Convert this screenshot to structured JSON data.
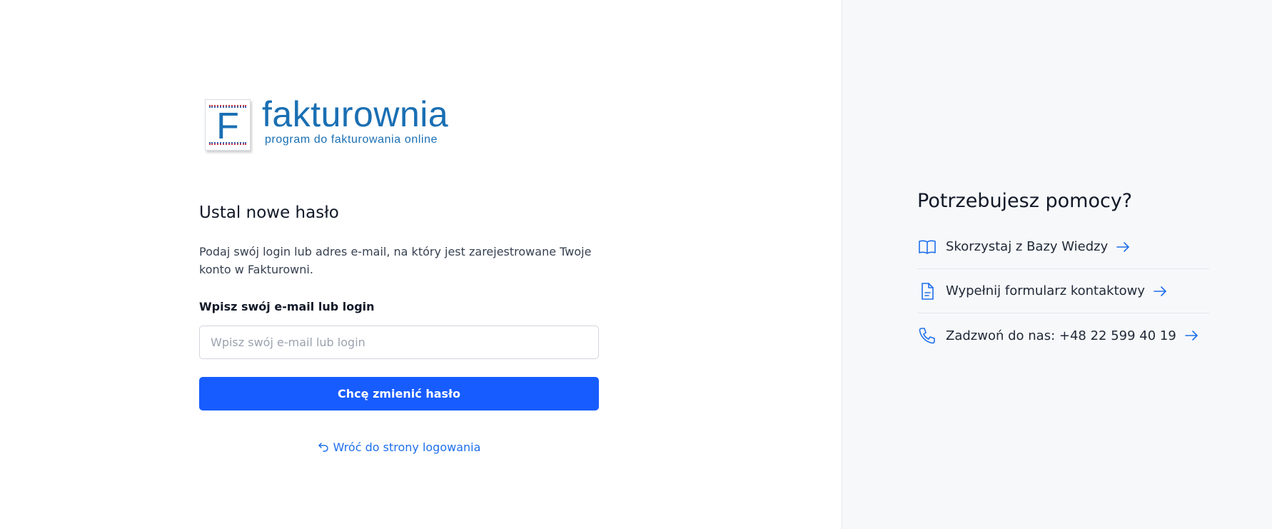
{
  "brand": {
    "logo_letter": "F",
    "name": "fakturownia",
    "tagline": "program do fakturowania online",
    "color": "#1a6fb3"
  },
  "form": {
    "title": "Ustal nowe hasło",
    "description": "Podaj swój login lub adres e-mail, na który jest zarejestrowane Twoje konto w Fakturowni.",
    "field_label": "Wpisz swój e-mail lub login",
    "field_placeholder": "Wpisz swój e-mail lub login",
    "field_value": "",
    "submit_label": "Chcę zmienić hasło",
    "back_link_label": "Wróć do strony logowania",
    "back_link_icon": "return-arrow-icon",
    "accent_color": "#175cff"
  },
  "help": {
    "title": "Potrzebujesz pomocy?",
    "items": [
      {
        "label": "Skorzystaj z Bazy Wiedzy",
        "icon": "book-icon"
      },
      {
        "label": "Wypełnij formularz kontaktowy",
        "icon": "document-icon"
      },
      {
        "label": "Zadzwoń do nas: +48 22 599 40 19",
        "icon": "phone-icon"
      }
    ],
    "arrow_icon": "arrow-right-icon",
    "icon_color": "#1f6feb"
  }
}
